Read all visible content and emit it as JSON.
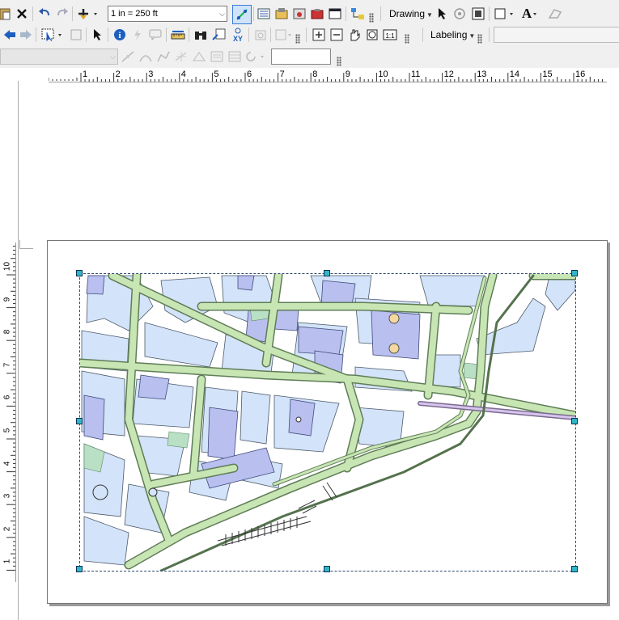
{
  "toolbar1": {
    "scale_value": "1 in = 250 ft",
    "drawing_label": "Drawing",
    "text_tool_glyph": "A"
  },
  "toolbar2": {
    "labeling_label": "Labeling"
  },
  "toolbar3": {
    "target_combo_value": "",
    "sketch_input_value": ""
  },
  "rulers": {
    "horizontal": [
      "1",
      "2",
      "3",
      "4",
      "5",
      "6",
      "7",
      "8",
      "9",
      "10",
      "11",
      "12",
      "13",
      "14",
      "15",
      "16"
    ],
    "vertical": [
      "10",
      "9",
      "8",
      "7",
      "6",
      "5",
      "4",
      "3",
      "2",
      "1"
    ]
  },
  "colors": {
    "building_light": "#d3e3f9",
    "building_purple": "#b9bfef",
    "road_green": "#c8e6b4",
    "road_edge": "#6b8a62",
    "selection_handle": "#2fb6c9"
  }
}
